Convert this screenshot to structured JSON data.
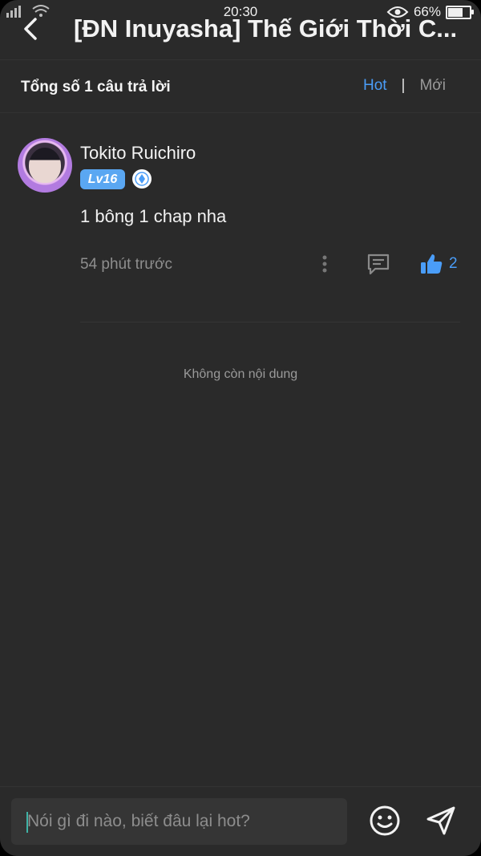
{
  "status_bar": {
    "time": "20:30",
    "battery": "66%",
    "battery_level": 0.66
  },
  "header": {
    "title": "[ĐN Inuyasha] Thế Giới Thời C..."
  },
  "sort_bar": {
    "count_text": "Tổng số 1 câu trả lời",
    "hot_label": "Hot",
    "separator": "|",
    "new_label": "Mới"
  },
  "answer": {
    "username": "Tokito Ruichiro",
    "level": "Lv16",
    "content": "1 bông 1 chap nha",
    "time": "54 phút trước",
    "like_count": "2"
  },
  "end_text": "Không còn nội dung",
  "composer": {
    "placeholder": "Nói gì đi nào, biết đâu lại hot?"
  },
  "colors": {
    "accent": "#4a9df8",
    "background": "#2a2a2a"
  }
}
